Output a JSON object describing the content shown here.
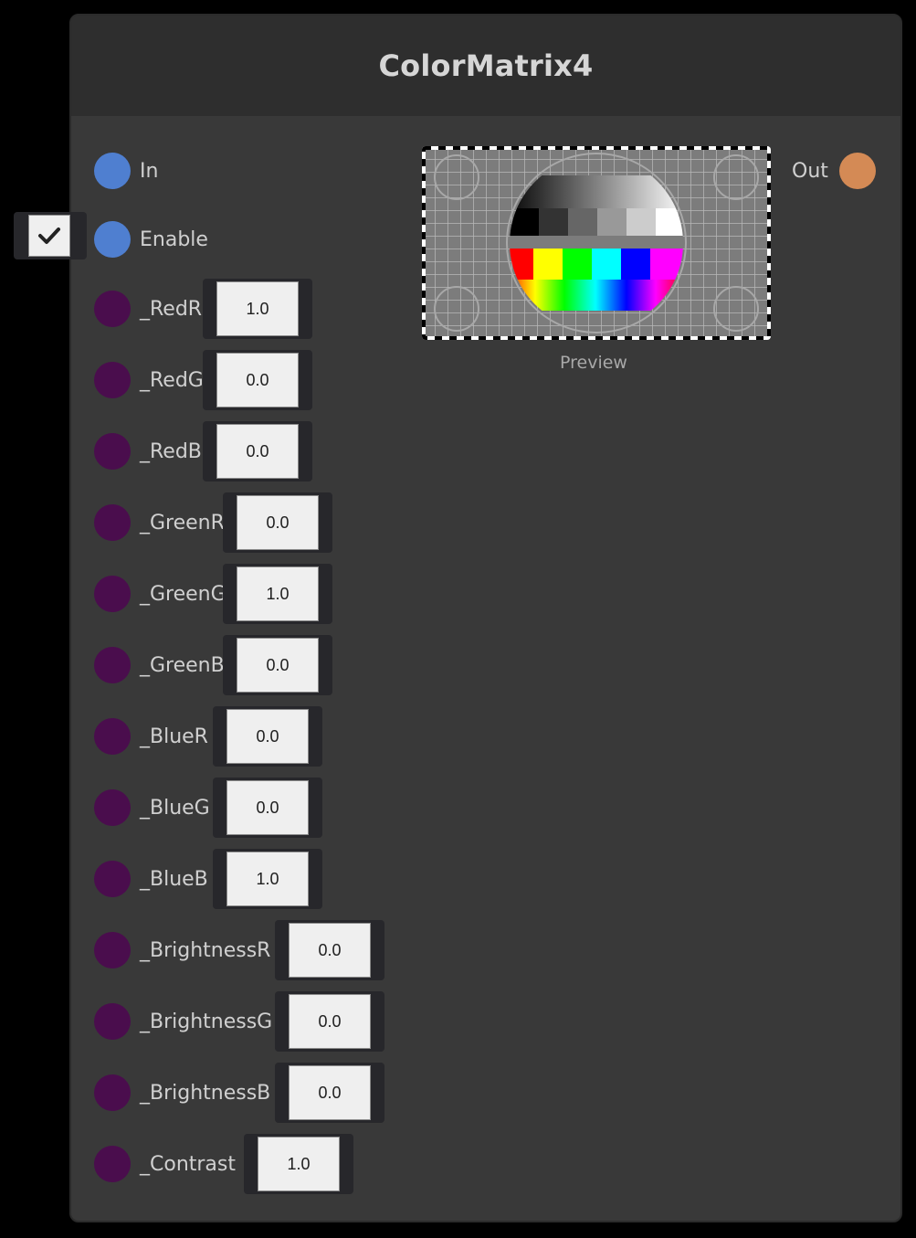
{
  "node": {
    "title": "ColorMatrix4"
  },
  "ports": {
    "in_label": "In",
    "enable_label": "Enable",
    "out_label": "Out",
    "enable_checked": true
  },
  "params": [
    {
      "label": "_RedR",
      "value": "1.0"
    },
    {
      "label": "_RedG",
      "value": "0.0"
    },
    {
      "label": "_RedB",
      "value": "0.0"
    },
    {
      "label": "_GreenR",
      "value": "0.0"
    },
    {
      "label": "_GreenG",
      "value": "1.0"
    },
    {
      "label": "_GreenB",
      "value": "0.0"
    },
    {
      "label": "_BlueR",
      "value": "0.0"
    },
    {
      "label": "_BlueG",
      "value": "0.0"
    },
    {
      "label": "_BlueB",
      "value": "1.0"
    },
    {
      "label": "_BrightnessR",
      "value": "0.0"
    },
    {
      "label": "_BrightnessG",
      "value": "0.0"
    },
    {
      "label": "_BrightnessB",
      "value": "0.0"
    },
    {
      "label": "_Contrast",
      "value": "1.0"
    }
  ],
  "preview": {
    "label": "Preview"
  },
  "colors": {
    "input_port": "#4f7fd0",
    "param_port": "#4a0d4d",
    "output_port": "#d48a55",
    "node_body": "#393939",
    "node_header": "#2e2e2e"
  }
}
